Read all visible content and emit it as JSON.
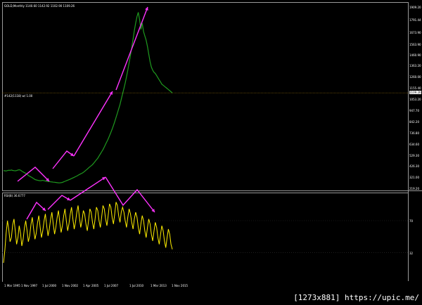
{
  "chart": {
    "title": "GOLD,Monthly  1140.60 1142.92 1102.90 1109.26",
    "line_label": "#142(1118) w/ 1.00",
    "current_price_label": "1109.26",
    "rsi_title": "RSI(8) 36.6777",
    "watermark": "[1273x881] https://upic.me/"
  },
  "chart_data": [
    {
      "type": "line",
      "title": "GOLD,Monthly  1140.60 1142.92 1102.90 1109.26",
      "y_ticks": [
        "1909.20",
        "1791.44",
        "1673.90",
        "1563.90",
        "1460.90",
        "1363.20",
        "1260.00",
        "1155.40",
        "1053.20",
        "947.70",
        "842.20",
        "736.80",
        "634.60",
        "529.30",
        "426.30",
        "321.00",
        "219.20"
      ],
      "x_ticks": [
        "1 Mar 1995",
        "1 Nov 1997",
        "1 Jul 2000",
        "1 Nov 2002",
        "1 Apr 2005",
        "1 Jul 2007",
        "1 Jul 2010",
        "1 Mar 2013",
        "1 Nov 2015"
      ],
      "ylim": [
        219.2,
        1909.2
      ],
      "series": [
        {
          "values": [
            384,
            383,
            381,
            385,
            388,
            387,
            390,
            386,
            384,
            383,
            385,
            390,
            392,
            388,
            380,
            372,
            365,
            358,
            350,
            340,
            332,
            325,
            318,
            310,
            302,
            298,
            295,
            292,
            290,
            291,
            294,
            290,
            287,
            285,
            283,
            282,
            280,
            279,
            277,
            276,
            274,
            272,
            271,
            270,
            272,
            275,
            280,
            285,
            290,
            295,
            300,
            305,
            310,
            316,
            322,
            328,
            334,
            341,
            348,
            355,
            360,
            368,
            378,
            388,
            398,
            410,
            420,
            430,
            440,
            455,
            470,
            485,
            500,
            520,
            540,
            560,
            580,
            605,
            630,
            655,
            680,
            710,
            740,
            770,
            805,
            840,
            880,
            920,
            960,
            1000,
            1050,
            1100,
            1150,
            1200,
            1260,
            1320,
            1390,
            1460,
            1530,
            1610,
            1690,
            1760,
            1820,
            1860,
            1790,
            1700,
            1760,
            1680,
            1640,
            1600,
            1540,
            1470,
            1400,
            1350,
            1320,
            1300,
            1290,
            1270,
            1250,
            1230,
            1210,
            1190,
            1180,
            1170,
            1160,
            1150,
            1140,
            1130,
            1120,
            1109
          ]
        }
      ],
      "reference_line": 1109.26
    },
    {
      "type": "line",
      "title": "RSI(8) 36.6777",
      "y_ticks": [
        "70",
        "32"
      ],
      "ylim": [
        0,
        100
      ],
      "series": [
        {
          "values": [
            20,
            35,
            55,
            70,
            60,
            45,
            50,
            65,
            72,
            58,
            42,
            50,
            64,
            55,
            40,
            48,
            62,
            70,
            58,
            45,
            52,
            66,
            74,
            60,
            48,
            55,
            68,
            76,
            62,
            50,
            58,
            70,
            78,
            64,
            52,
            60,
            72,
            80,
            66,
            54,
            62,
            74,
            82,
            68,
            56,
            64,
            76,
            84,
            70,
            58,
            66,
            78,
            86,
            72,
            60,
            68,
            80,
            88,
            74,
            62,
            70,
            82,
            78,
            66,
            58,
            70,
            84,
            80,
            68,
            60,
            72,
            86,
            82,
            70,
            62,
            74,
            88,
            84,
            72,
            64,
            76,
            90,
            86,
            74,
            66,
            78,
            92,
            88,
            76,
            68,
            80,
            86,
            80,
            70,
            62,
            74,
            84,
            78,
            68,
            60,
            72,
            80,
            74,
            62,
            54,
            66,
            76,
            70,
            58,
            50,
            62,
            72,
            66,
            54,
            46,
            58,
            68,
            62,
            50,
            42,
            54,
            64,
            58,
            46,
            38,
            50,
            60,
            54,
            42,
            36
          ]
        }
      ]
    }
  ],
  "arrows_color": "#ff33ff",
  "price_color": "#1f9a1f",
  "rsi_color": "#ffee00"
}
